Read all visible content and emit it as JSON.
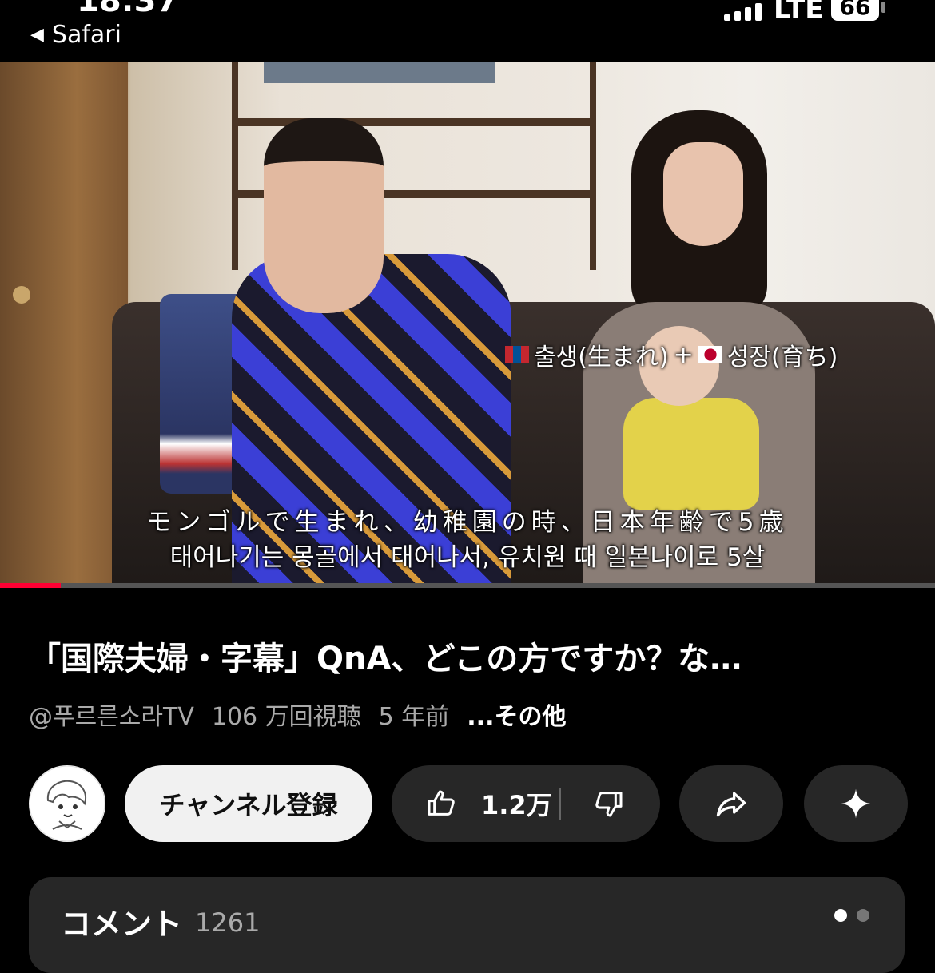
{
  "status_bar": {
    "back_app": "Safari",
    "network": "LTE",
    "battery": "66"
  },
  "video": {
    "overlay_caption_part1": "출생(生まれ)",
    "overlay_plus": "+",
    "overlay_caption_part2": "성장(育ち)",
    "subtitle_jp": "モンゴルで生まれ、幼稚園の時、日本年齢で5歳",
    "subtitle_ko": "태어나기는 몽골에서 태어나서, 유치원 때 일본나이로 5살",
    "progress": 0.065,
    "progress_color": "#ff0033"
  },
  "title": "「国際夫婦・字幕」QnA、どこの方ですか？な…",
  "meta": {
    "channel": "@푸르른소라TV",
    "views": "106 万回視聴",
    "age": "5 年前",
    "more": "...その他"
  },
  "actions": {
    "subscribe": "チャンネル登録",
    "likes": "1.2万",
    "like_icon": "thumbs-up-icon",
    "dislike_icon": "thumbs-down-icon",
    "share_icon": "share-icon",
    "remix_icon": "sparkle-icon"
  },
  "comments": {
    "title": "コメント",
    "count": "1261"
  }
}
